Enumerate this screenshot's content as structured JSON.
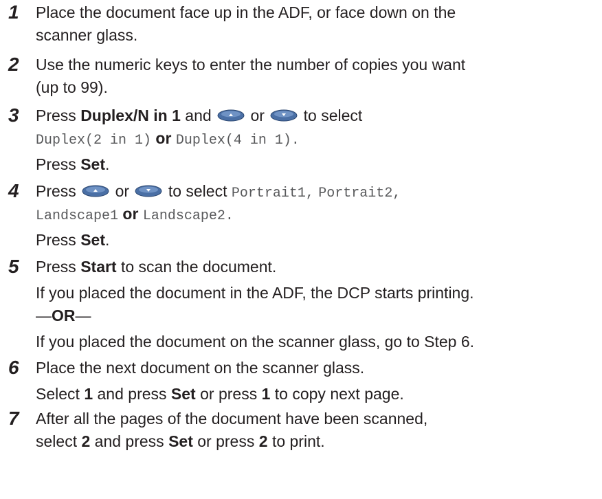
{
  "steps": [
    {
      "number": "1",
      "line1": "Place the document face up in the ADF, or face down on the",
      "line2": "scanner glass."
    },
    {
      "number": "2",
      "line1": "Use the numeric keys to enter the number of copies you want",
      "line2": "(up to 99)."
    },
    {
      "number": "3",
      "press": "Press",
      "key_name": "Duplex/N in 1",
      "and": "and",
      "or": "or",
      "to_select": "to select",
      "option1": "Duplex(2 in 1)",
      "or2": "or",
      "option2": "Duplex(4 in 1)",
      "period": ".",
      "press2": "Press",
      "set": "Set",
      "period2": "."
    },
    {
      "number": "4",
      "press": "Press",
      "or": "or",
      "to_select": "to select",
      "opt1": "Portrait1",
      "comma1": ",",
      "opt2": "Portrait2",
      "comma2": ",",
      "opt3": "Landscape1",
      "or2": "or",
      "opt4": "Landscape2",
      "period": ".",
      "press2": "Press",
      "set": "Set",
      "period2": "."
    },
    {
      "number": "5",
      "press": "Press",
      "start": "Start",
      "rest": "to scan the document.",
      "adf_line": "If you placed the document in the ADF, the DCP starts printing.",
      "or_dash": "—",
      "or_word": "OR",
      "or_dash2": "—",
      "glass_line": "If you placed the document on the scanner glass, go to Step 6."
    },
    {
      "number": "6",
      "line1": "Place the next document on the scanner glass.",
      "select": "Select",
      "one": "1",
      "and_press": "and press",
      "set": "Set",
      "or_press": "or press",
      "one2": "1",
      "rest": "to copy next page."
    },
    {
      "number": "7",
      "line1": "After all the pages of the document have been scanned,",
      "select": "select",
      "two": "2",
      "and_press": "and press",
      "set": "Set",
      "or_press": "or press",
      "two2": "2",
      "rest": "to print."
    }
  ],
  "icons": {
    "up_key": "up-arrow-key-icon",
    "down_key": "down-arrow-key-icon",
    "key_color": "#4a6fa5"
  }
}
